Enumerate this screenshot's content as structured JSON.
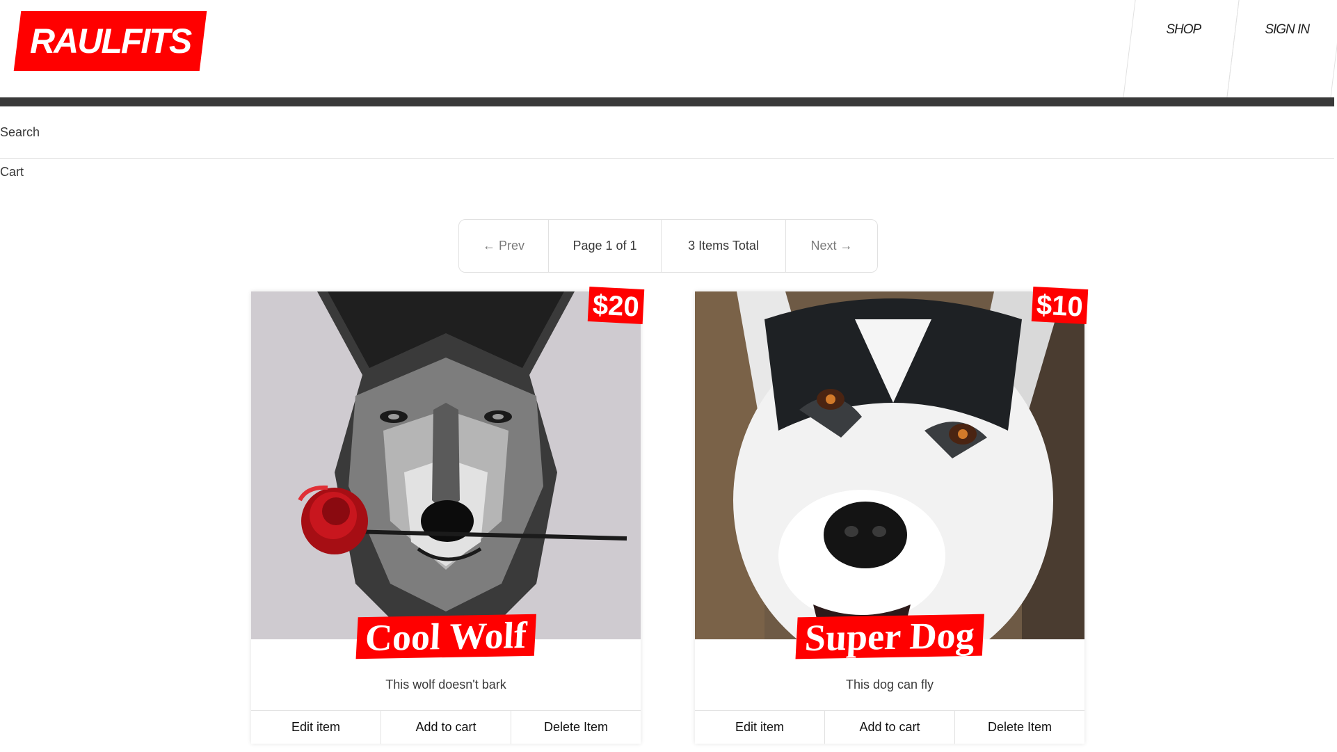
{
  "header": {
    "logo_text": "RAULFITS",
    "nav": [
      "SHOP",
      "SIGN IN"
    ]
  },
  "search_label": "Search",
  "cart_label": "Cart",
  "pagination": {
    "prev": "← Prev",
    "page": "Page 1 of 1",
    "total": "3 Items Total",
    "next": "Next →"
  },
  "products": [
    {
      "title": "Cool Wolf",
      "price": "$20",
      "description": "This wolf doesn't bark",
      "image_icon": "wolf-with-rose-image",
      "actions": [
        "Edit item",
        "Add to cart",
        "Delete Item"
      ]
    },
    {
      "title": "Super Dog",
      "price": "$10",
      "description": "This dog can fly",
      "image_icon": "husky-dog-image",
      "actions": [
        "Edit item",
        "Add to cart",
        "Delete Item"
      ]
    }
  ],
  "colors": {
    "brand_red": "#ff0000",
    "dark_bar": "#393939",
    "border": "#e1e1e1"
  }
}
